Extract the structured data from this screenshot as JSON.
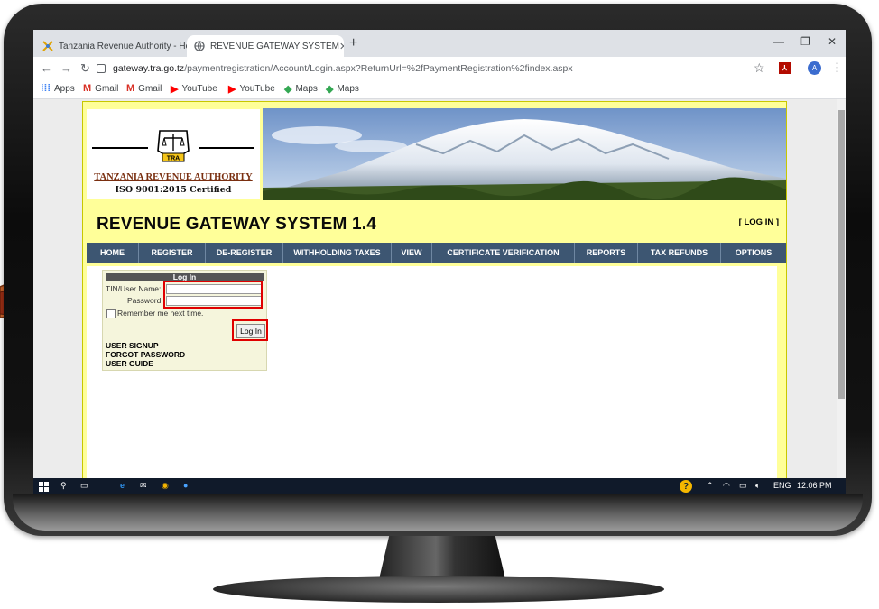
{
  "browser": {
    "tabs": [
      {
        "title": "Tanzania Revenue Authority - Ho",
        "active": false
      },
      {
        "title": "REVENUE GATEWAY SYSTEM",
        "active": true
      }
    ],
    "new_tab": "+",
    "url_host": "gateway.tra.go.tz",
    "url_path": "/paymentregistration/Account/Login.aspx?ReturnUrl=%2fPaymentRegistration%2findex.aspx",
    "profile_initial": "A",
    "bookmarks": [
      "Apps",
      "Gmail",
      "Gmail",
      "YouTube",
      "YouTube",
      "Maps",
      "Maps"
    ]
  },
  "site": {
    "logo": {
      "name": "TANZANIA REVENUE AUTHORITY",
      "certification": "ISO 9001:2015 Certified",
      "emblem_text": "TRA"
    },
    "system_title": "REVENUE GATEWAY SYSTEM 1.4",
    "login_link": "[ LOG IN ]",
    "menu": [
      "HOME",
      "REGISTER",
      "DE-REGISTER",
      "WITHHOLDING TAXES",
      "VIEW",
      "CERTIFICATE VERIFICATION",
      "REPORTS",
      "TAX REFUNDS",
      "OPTIONS"
    ],
    "login_box": {
      "header": "Log In",
      "username_label": "TIN/User Name:",
      "username_value": "",
      "password_label": "Password:",
      "password_value": "",
      "remember_label": "Remember me next time.",
      "remember_checked": false,
      "submit_label": "Log In",
      "links": [
        "USER SIGNUP",
        "FORGOT PASSWORD",
        "USER GUIDE"
      ]
    }
  },
  "taskbar": {
    "language": "ENG",
    "time": "12:06 PM"
  },
  "colors": {
    "page_background": "#ffff99",
    "menu_bar": "#3d5672",
    "highlight": "#e00000"
  }
}
